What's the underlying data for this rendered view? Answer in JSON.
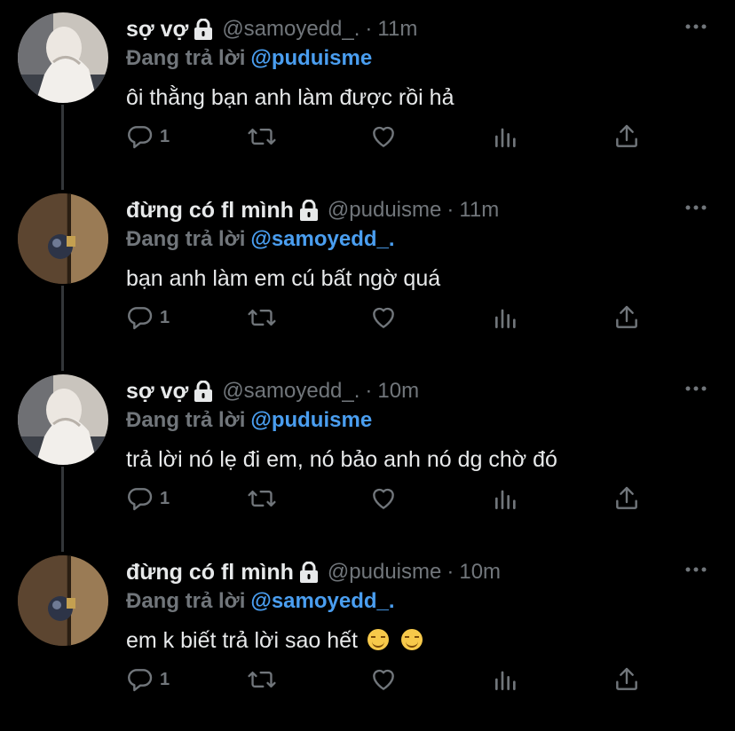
{
  "tweets": [
    {
      "name": "sợ vợ",
      "handle": "@samoyedd_.",
      "dot": "·",
      "time": "11m",
      "replying_label": "Đang trả lời",
      "replying_to": "@puduisme",
      "text": "ôi thằng bạn anh làm được rồi hả",
      "reply_count": "1",
      "avatar": "avatar-person-hoodie"
    },
    {
      "name": "đừng có fl mình",
      "handle": "@puduisme",
      "dot": "·",
      "time": "11m",
      "replying_label": "Đang trả lời",
      "replying_to": "@samoyedd_.",
      "text": "bạn anh làm em cú bất ngờ quá",
      "reply_count": "1",
      "avatar": "avatar-door-knob"
    },
    {
      "name": "sợ vợ",
      "handle": "@samoyedd_.",
      "dot": "·",
      "time": "10m",
      "replying_label": "Đang trả lời",
      "replying_to": "@puduisme",
      "text": "trả lời nó lẹ đi em, nó bảo anh nó dg chờ đó",
      "reply_count": "1",
      "avatar": "avatar-person-hoodie"
    },
    {
      "name": "đừng có fl mình",
      "handle": "@puduisme",
      "dot": "·",
      "time": "10m",
      "replying_label": "Đang trả lời",
      "replying_to": "@samoyedd_.",
      "text": "em k biết trả lời sao hết",
      "reply_count": "1",
      "avatar": "avatar-door-knob",
      "emoji": "smiling-face-emoji"
    }
  ],
  "icons": [
    "lock-icon",
    "more-icon",
    "reply-icon",
    "retweet-icon",
    "like-icon",
    "analytics-icon",
    "share-icon"
  ],
  "colors": {
    "background": "#000000",
    "text": "#e7e9ea",
    "muted": "#71767b",
    "mention": "#4a9ef0",
    "thread_line": "#333639"
  }
}
